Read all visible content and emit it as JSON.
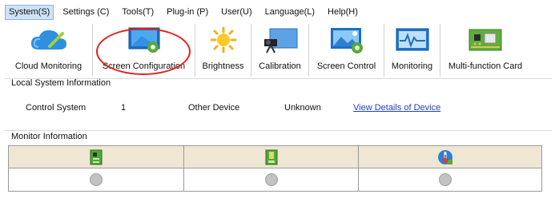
{
  "menubar": {
    "items": [
      {
        "label": "System(S)"
      },
      {
        "label": "Settings (C)"
      },
      {
        "label": "Tools(T)"
      },
      {
        "label": "Plug-in (P)"
      },
      {
        "label": "User(U)"
      },
      {
        "label": "Language(L)"
      },
      {
        "label": "Help(H)"
      }
    ]
  },
  "toolbar": {
    "items": [
      {
        "label": "Cloud Monitoring",
        "icon": "cloud-icon"
      },
      {
        "label": "Screen Configuration",
        "icon": "screen-config-icon"
      },
      {
        "label": "Brightness",
        "icon": "sun-icon"
      },
      {
        "label": "Calibration",
        "icon": "camera-icon"
      },
      {
        "label": "Screen Control",
        "icon": "screen-control-icon"
      },
      {
        "label": "Monitoring",
        "icon": "monitoring-icon"
      },
      {
        "label": "Multi-function Card",
        "icon": "circuit-card-icon"
      }
    ]
  },
  "local_system": {
    "title": "Local System Information",
    "control_system_label": "Control System",
    "control_system_value": "1",
    "other_device_label": "Other Device",
    "other_device_value": "Unknown",
    "details_link": "View Details of Device"
  },
  "monitor": {
    "title": "Monitor Information",
    "columns": [
      {
        "icon": "green-card-icon",
        "status": "gray"
      },
      {
        "icon": "green-module-icon",
        "status": "gray"
      },
      {
        "icon": "thermometer-icon",
        "status": "gray"
      }
    ]
  },
  "colors": {
    "highlight": "#e0231e",
    "link": "#1f3fd1",
    "grid_header": "#efe6d4"
  }
}
